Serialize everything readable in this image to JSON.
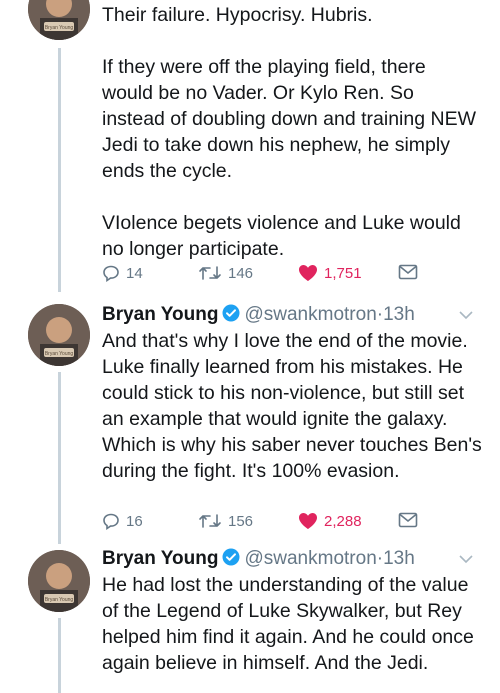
{
  "tweets": [
    {
      "paragraphs": [
        "Their failure. Hypocrisy. Hubris.",
        "If they were off the playing field, there would be no Vader. Or Kylo Ren. So instead of doubling down and training NEW Jedi to take down his nephew, he simply ends the cycle.",
        "VIolence begets violence and Luke would no longer participate."
      ],
      "replies": "14",
      "retweets": "146",
      "likes": "1,751"
    },
    {
      "name": "Bryan Young",
      "handle": "@swankmotron",
      "time": "13h",
      "text": "And that's why I love the end of the movie. Luke finally learned from his mistakes. He could stick to his non-violence, but still set an example that would ignite the galaxy. Which is why his saber never touches Ben's during the fight. It's 100% evasion.",
      "replies": "16",
      "retweets": "156",
      "likes": "2,288"
    },
    {
      "name": "Bryan Young",
      "handle": "@swankmotron",
      "time": "13h",
      "text": "He had lost the understanding of the value of the Legend of Luke Skywalker, but Rey helped him find it again. And he could once again believe in himself. And the Jedi."
    }
  ],
  "separator": "·",
  "avatar_badge": "Bryan Young",
  "colors": {
    "like": "#e0245e",
    "verified": "#1da1f2",
    "meta": "#657786"
  }
}
